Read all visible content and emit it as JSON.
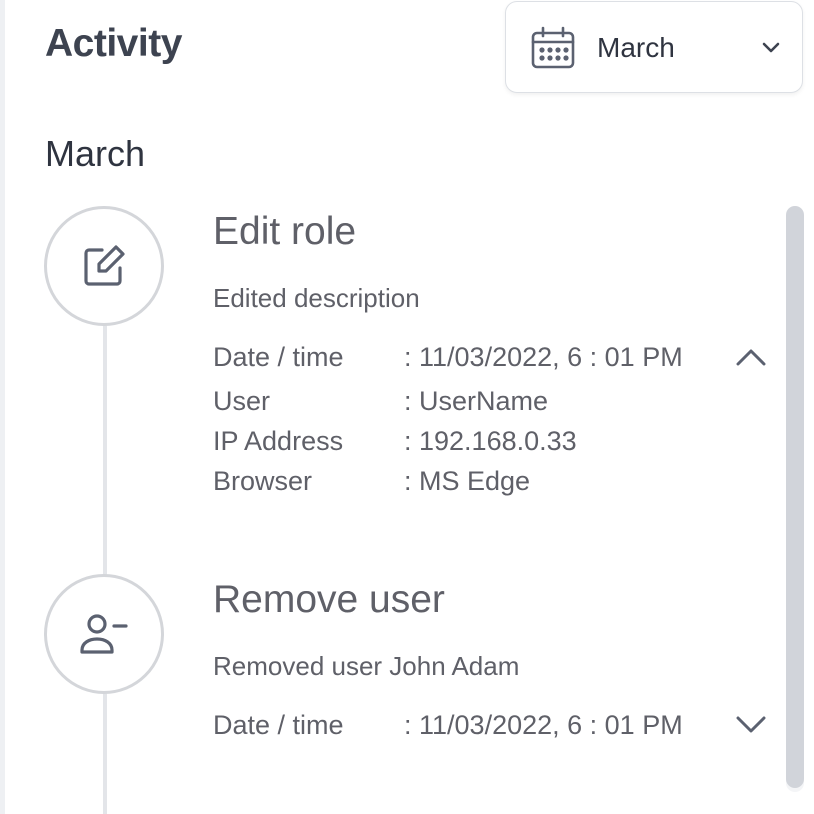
{
  "header": {
    "title": "Activity"
  },
  "month_picker": {
    "icon": "calendar-icon",
    "value": "March",
    "chevron": "chevron-down-icon"
  },
  "section": {
    "month": "March"
  },
  "events": [
    {
      "icon": "edit-icon",
      "title": "Edit role",
      "description": "Edited description",
      "expanded": true,
      "toggle_icon": "chevron-up-icon",
      "details": [
        {
          "key": "Date / time",
          "value": ": 11/03/2022, 6 : 01 PM"
        },
        {
          "key": "User",
          "value": ": UserName"
        },
        {
          "key": "IP Address",
          "value": ": 192.168.0.33"
        },
        {
          "key": "Browser",
          "value": ": MS Edge"
        }
      ]
    },
    {
      "icon": "user-minus-icon",
      "title": "Remove user",
      "description": "Removed user John Adam",
      "expanded": false,
      "toggle_icon": "chevron-down-icon",
      "details": [
        {
          "key": "Date / time",
          "value": ": 11/03/2022, 6 : 01 PM"
        }
      ]
    }
  ],
  "colors": {
    "text": "#5f6068",
    "heading": "#3d4350",
    "border": "#d4d6da",
    "scrollbar": "#d1d4da"
  }
}
